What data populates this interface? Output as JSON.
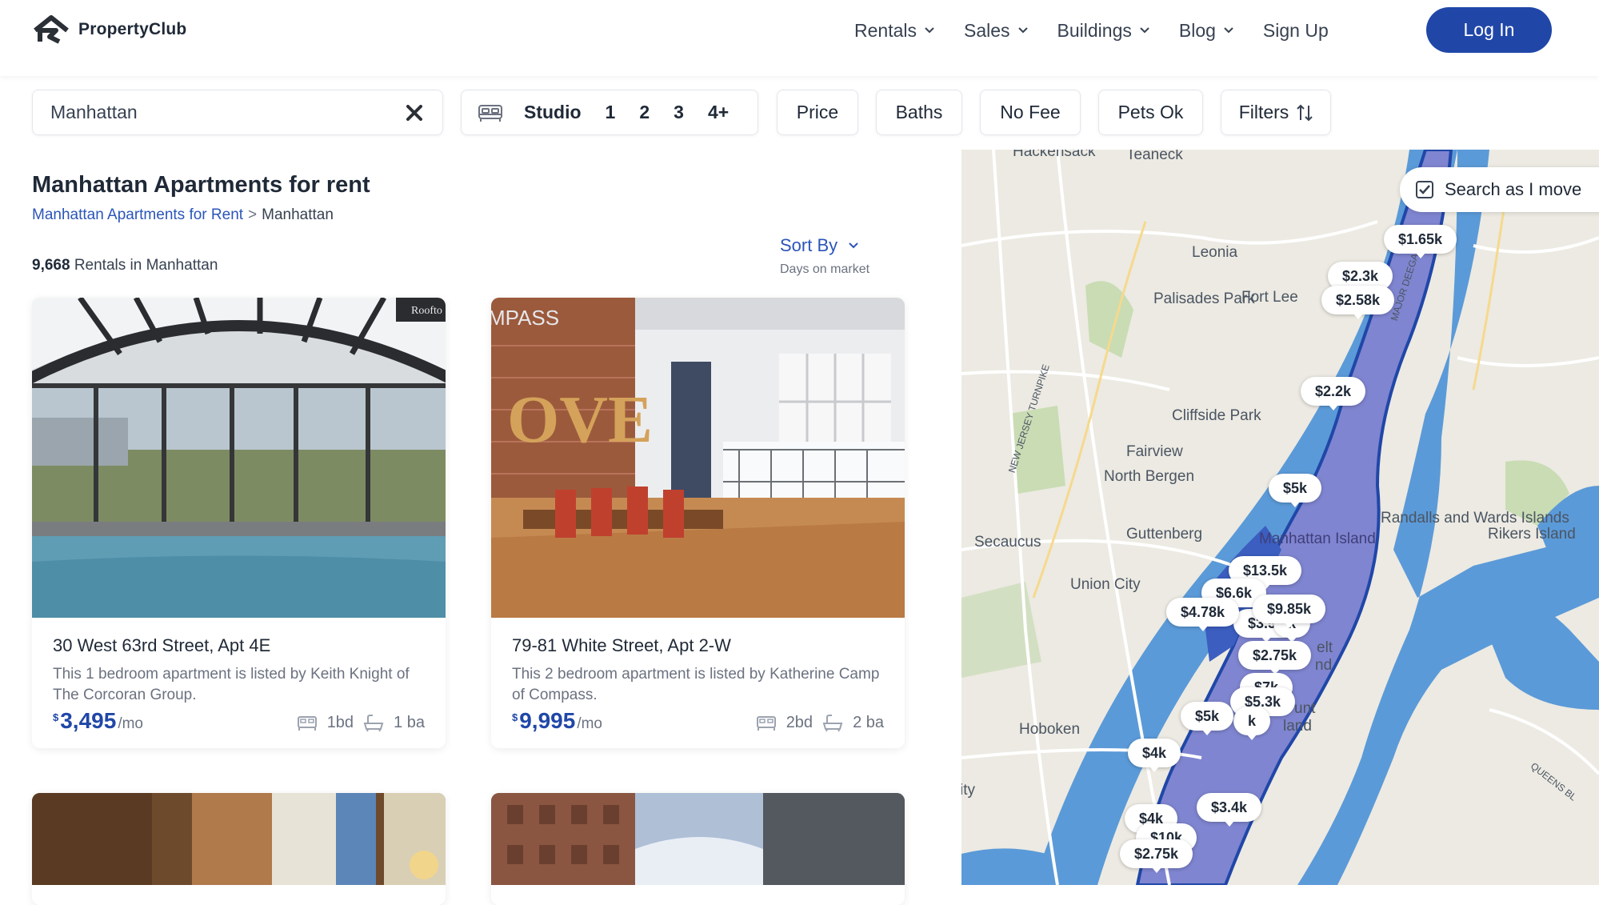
{
  "brand": {
    "name": "PropertyClub"
  },
  "nav": {
    "items": [
      {
        "label": "Rentals",
        "dropdown": true
      },
      {
        "label": "Sales",
        "dropdown": true
      },
      {
        "label": "Buildings",
        "dropdown": true
      },
      {
        "label": "Blog",
        "dropdown": true
      },
      {
        "label": "Sign Up",
        "dropdown": false
      }
    ],
    "login_label": "Log In"
  },
  "filters": {
    "search_value": "Manhattan",
    "beds": [
      "Studio",
      "1",
      "2",
      "3",
      "4+"
    ],
    "chips": [
      "Price",
      "Baths",
      "No Fee",
      "Pets Ok",
      "Filters"
    ]
  },
  "listing_page": {
    "title": "Manhattan Apartments for rent",
    "breadcrumb": {
      "link": "Manhattan Apartments for Rent",
      "separator": ">",
      "current": "Manhattan"
    },
    "count_number": "9,668",
    "count_text": "Rentals in Manhattan",
    "sort_label": "Sort By",
    "sort_value": "Days on market"
  },
  "listings": [
    {
      "address": "30 West 63rd Street, Apt 4E",
      "description": "This 1 bedroom apartment is listed by Keith Knight of The Corcoran Group.",
      "currency": "$",
      "price": "3,495",
      "price_unit": "/mo",
      "beds": "1bd",
      "baths": "1 ba",
      "photo_tag": "Roofto"
    },
    {
      "address": "79-81 White Street, Apt 2-W",
      "description": "This 2 bedroom apartment is listed by Katherine Camp of Compass.",
      "currency": "$",
      "price": "9,995",
      "price_unit": "/mo",
      "beds": "2bd",
      "baths": "2 ba",
      "photo_tag": "MPASS",
      "wall_sign": "OVE"
    }
  ],
  "map": {
    "search_as_move_label": "Search as I move",
    "search_as_move_checked": true,
    "places": [
      "Hackensack",
      "Teaneck",
      "Leonia",
      "Palisades Park",
      "Fort Lee",
      "Cliffside Park",
      "Fairview",
      "North Bergen",
      "Secaucus",
      "Guttenberg",
      "Union City",
      "Hoboken",
      "ity",
      "Manhattan Island",
      "Randalls and Wards Islands",
      "Rikers Island",
      "NEW JERSEY TURNPIKE",
      "MAJOR DEEGAN",
      "QUEENS BL",
      "elt",
      "nd",
      "unt",
      "land"
    ],
    "price_pins": [
      "$1.65k",
      "$2.3k",
      "$2.58k",
      "$2.2k",
      "$5k",
      "$13.5k",
      "$6.6k",
      "$4.78k",
      "$9.85k",
      "$2.75k",
      "$5.3k",
      "$5k",
      "$4k",
      "$4k",
      "$3.4k",
      "$2.75k",
      "k",
      "k",
      "$3.5k",
      "$7k",
      "$10k"
    ]
  }
}
